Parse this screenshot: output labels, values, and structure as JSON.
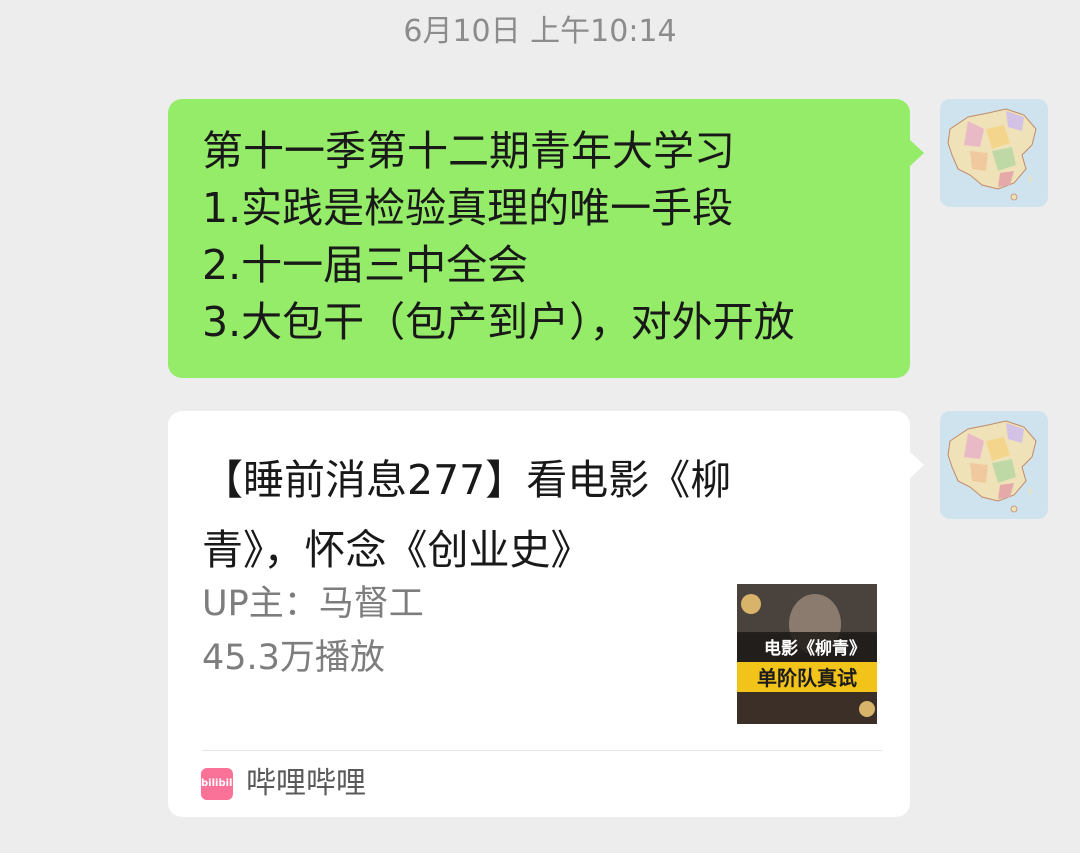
{
  "timestamp": "6月10日 上午10:14",
  "colors": {
    "background": "#ededed",
    "sent_bubble": "#95ec69",
    "card": "#ffffff",
    "bilibili_pink": "#fb7299"
  },
  "messages": [
    {
      "type": "text",
      "sender_avatar": "china-map-avatar",
      "lines": [
        "第十一季第十二期青年大学习",
        "1.实践是检验真理的唯一手段",
        "2.十一届三中全会",
        "3.大包干（包产到户），对外开放"
      ]
    },
    {
      "type": "link_card",
      "sender_avatar": "china-map-avatar",
      "title": "【睡前消息277】看电影《柳青》，怀念《创业史》",
      "uploader": "UP主：马督工",
      "plays": "45.3万播放",
      "thumbnail": {
        "text_top": "电影《柳青》",
        "text_bottom": "单阶队真试"
      },
      "source": {
        "icon_text": "bilibili",
        "name": "哔哩哔哩"
      }
    }
  ]
}
